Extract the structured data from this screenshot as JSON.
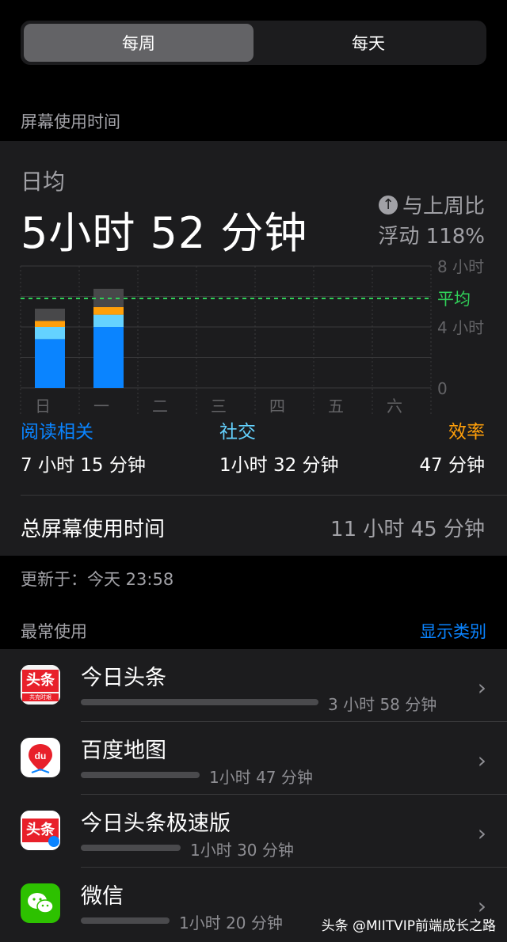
{
  "segment": {
    "week": "每周",
    "day": "每天"
  },
  "screen_time_header": "屏幕使用时间",
  "summary": {
    "daily_label": "日均",
    "daily_value": "5小时 52 分钟",
    "compare_line1": "与上周比",
    "compare_line2": "浮动 118%",
    "compare_icon": "arrow-up-circle-icon"
  },
  "chart_data": {
    "type": "bar",
    "categories": [
      "日",
      "一",
      "二",
      "三",
      "四",
      "五",
      "六"
    ],
    "stacked": true,
    "ylim": [
      0,
      8
    ],
    "y_ticks": [
      "8 小时",
      "4 小时",
      "0"
    ],
    "average": 5.87,
    "average_label": "平均",
    "series": [
      {
        "values": [
          3.2,
          4.0,
          0,
          0,
          0,
          0,
          0
        ],
        "color": "#0a84ff"
      },
      {
        "values": [
          0.8,
          0.8,
          0,
          0,
          0,
          0,
          0
        ],
        "color": "#64d2ff"
      },
      {
        "values": [
          0.4,
          0.5,
          0,
          0,
          0,
          0,
          0
        ],
        "color": "#ff9f0a"
      },
      {
        "values": [
          0.8,
          1.2,
          0,
          0,
          0,
          0,
          0
        ],
        "color": "#48484a"
      }
    ],
    "colors": {
      "average_line": "#30d158",
      "grid": "#3a3a3c",
      "labels": "#636366"
    }
  },
  "categories": [
    {
      "name": "阅读相关",
      "time": "7 小时 15 分钟",
      "color": "#0a84ff"
    },
    {
      "name": "社交",
      "time": "1小时 32 分钟",
      "color": "#64d2ff"
    },
    {
      "name": "效率",
      "time": "47 分钟",
      "color": "#ff9f0a"
    }
  ],
  "total": {
    "label": "总屏幕使用时间",
    "value": "11 小时 45 分钟"
  },
  "updated": "更新于：今天 23:58",
  "most_used": {
    "title": "最常使用",
    "link": "显示类别"
  },
  "apps": [
    {
      "name": "今日头条",
      "time": "3 小时 58 分钟",
      "usage": 3.97,
      "icon": "toutiao-app-icon"
    },
    {
      "name": "百度地图",
      "time": "1小时 47 分钟",
      "usage": 1.78,
      "icon": "baidu-map-app-icon"
    },
    {
      "name": "今日头条极速版",
      "time": "1小时 30 分钟",
      "usage": 1.5,
      "icon": "toutiao-lite-app-icon"
    },
    {
      "name": "微信",
      "time": "1小时 20 分钟",
      "usage": 1.33,
      "icon": "wechat-app-icon"
    }
  ],
  "icon_text": {
    "toutiao": "头条",
    "toutiao_sub": "共克时艰",
    "baidu": "du"
  },
  "watermark": "头条 @MIITVIP前端成长之路"
}
